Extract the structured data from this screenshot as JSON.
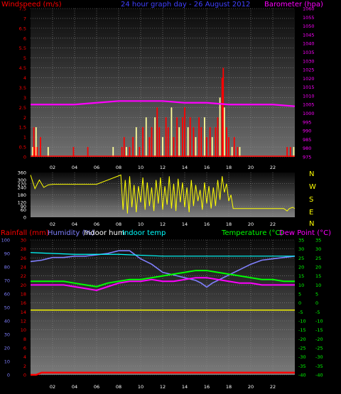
{
  "page": {
    "title_left": "Windspeed (m/s)",
    "title_mid": "24 hour graph day - 26 August 2012",
    "title_right": "Barometer (hpa)",
    "dir_letters": [
      "N",
      "W",
      "S",
      "E",
      "N"
    ],
    "bottom_labels": {
      "rain": "Rainfall (mm)",
      "hum": "Humidity (%)",
      "inhum": "Indoor hum",
      "intemp": "Indoor temp",
      "temp": "Temperature (°C)",
      "dew": "Dew Point (°C)"
    }
  },
  "colors": {
    "wind_bar": "#ff0000",
    "gust_bar": "#ffff99",
    "barometer": "#ff00ff",
    "direction": "#ffff00",
    "rain": "#ff0000",
    "humidity": "#8080ff",
    "indoor_hum": "#ffff00",
    "indoor_temp": "#00ffff",
    "temperature": "#00ff00",
    "dewpoint": "#ff00ff",
    "grid": "#8a8a8a"
  },
  "chart_data": [
    {
      "type": "bar",
      "x_ticks": [
        "02",
        "04",
        "06",
        "08",
        "10",
        "12",
        "14",
        "16",
        "18",
        "20",
        "22"
      ],
      "ylim": [
        0,
        7.5
      ],
      "y_ticks": [
        "0",
        "0.5",
        "1",
        "1.5",
        "2",
        "2.5",
        "3",
        "3.5",
        "4",
        "4.5",
        "5",
        "5.5",
        "6",
        "6.5",
        "7",
        "7.5"
      ],
      "y2lim": [
        975,
        1060
      ],
      "y2_ticks": [
        "975",
        "980",
        "985",
        "990",
        "995",
        "1000",
        "1005",
        "1010",
        "1015",
        "1020",
        "1025",
        "1030",
        "1035",
        "1040",
        "1045",
        "1050",
        "1055",
        "1060"
      ],
      "series": [
        {
          "name": "Windspeed (m/s)",
          "x": [
            0.2,
            0.3,
            0.4,
            0.5,
            0.6,
            0.9,
            1.6,
            3.9,
            5.2,
            7.5,
            8.3,
            8.5,
            8.7,
            9.0,
            9.3,
            9.6,
            9.9,
            10.2,
            10.5,
            10.8,
            11.0,
            11.3,
            11.5,
            11.7,
            12.0,
            12.3,
            12.5,
            12.8,
            13.0,
            13.3,
            13.5,
            13.8,
            14.0,
            14.3,
            14.5,
            14.8,
            15.0,
            15.3,
            15.5,
            15.8,
            16.0,
            16.3,
            16.5,
            16.8,
            17.0,
            17.2,
            17.4,
            17.5,
            17.6,
            17.8,
            18.0,
            18.3,
            18.5,
            18.8,
            19.0,
            23.3,
            23.6,
            23.9
          ],
          "y": [
            0.5,
            1.5,
            0.5,
            1.5,
            0.5,
            1,
            0.5,
            0.5,
            0.5,
            0.5,
            0.5,
            1,
            0.5,
            0.5,
            1,
            1.5,
            0.5,
            1.5,
            2,
            1,
            1.5,
            2,
            2.5,
            1.5,
            1,
            2,
            1.5,
            2.5,
            1,
            2,
            1.5,
            2,
            2.5,
            1.5,
            2,
            1.5,
            1,
            2,
            1.5,
            2,
            1,
            1.5,
            1,
            1.5,
            2,
            3,
            4,
            4.5,
            2.5,
            1.5,
            1,
            0.5,
            1,
            0.5,
            0.5,
            0.5,
            0.5,
            0.5
          ]
        },
        {
          "name": "Barometer (hpa)",
          "x": [
            0,
            2,
            4,
            6,
            8,
            10,
            12,
            14,
            16,
            18,
            20,
            22,
            24
          ],
          "y": [
            1005,
            1005,
            1005,
            1006,
            1007,
            1007,
            1007,
            1006,
            1006,
            1005,
            1005,
            1005,
            1004
          ]
        }
      ]
    },
    {
      "type": "line",
      "x_ticks": [
        "02",
        "04",
        "06",
        "08",
        "10",
        "12",
        "14",
        "16",
        "18",
        "20",
        "22"
      ],
      "ylim": [
        0,
        360
      ],
      "y_ticks": [
        "0",
        "30",
        "60",
        "90",
        "120",
        "150",
        "180",
        "210",
        "240",
        "270",
        "300",
        "330",
        "360"
      ],
      "series": [
        {
          "name": "Direction",
          "x": [
            0,
            0.4,
            0.8,
            1.2,
            1.6,
            2,
            4,
            6,
            8.2,
            8.4,
            8.6,
            8.8,
            9.0,
            9.2,
            9.4,
            9.6,
            9.8,
            10.0,
            10.2,
            10.4,
            10.6,
            10.8,
            11.0,
            11.2,
            11.4,
            11.6,
            11.8,
            12.0,
            12.2,
            12.4,
            12.6,
            12.8,
            13.0,
            13.2,
            13.4,
            13.6,
            13.8,
            14.0,
            14.2,
            14.4,
            14.6,
            14.8,
            15.0,
            15.2,
            15.4,
            15.6,
            15.8,
            16.0,
            16.2,
            16.4,
            16.6,
            16.8,
            17.0,
            17.2,
            17.4,
            17.6,
            17.8,
            18.0,
            18.2,
            18.4,
            18.6,
            19,
            21,
            23,
            23.3,
            23.5,
            23.8,
            24
          ],
          "y": [
            340,
            230,
            300,
            240,
            260,
            265,
            265,
            265,
            340,
            60,
            300,
            30,
            330,
            80,
            260,
            40,
            250,
            120,
            320,
            60,
            280,
            90,
            240,
            50,
            300,
            110,
            320,
            60,
            250,
            100,
            330,
            70,
            270,
            50,
            310,
            120,
            280,
            80,
            240,
            40,
            300,
            90,
            260,
            130,
            220,
            60,
            280,
            110,
            250,
            70,
            240,
            90,
            300,
            140,
            330,
            200,
            270,
            130,
            180,
            70,
            70,
            70,
            70,
            70,
            50,
            70,
            80,
            70
          ]
        }
      ]
    },
    {
      "type": "line",
      "x_ticks": [
        "02",
        "04",
        "06",
        "08",
        "10",
        "12",
        "14",
        "16",
        "18",
        "20",
        "22"
      ],
      "y_left_outer": {
        "label": "Humidity (%)",
        "ylim": [
          0,
          100
        ],
        "ticks": [
          "0",
          "10",
          "20",
          "30",
          "40",
          "50",
          "60",
          "70",
          "80",
          "90",
          "100"
        ]
      },
      "y_left_inner": {
        "label": "Rainfall (mm)",
        "ylim": [
          0,
          30
        ],
        "ticks": [
          "0",
          "2",
          "4",
          "6",
          "8",
          "10",
          "12",
          "14",
          "16",
          "18",
          "20",
          "22",
          "24",
          "26",
          "28",
          "30"
        ]
      },
      "y_right": {
        "label": "Temperature (°C)",
        "ylim": [
          -40,
          35
        ],
        "ticks": [
          "-40",
          "-35",
          "-30",
          "-25",
          "-20",
          "-15",
          "-10",
          "-5",
          "0",
          "5",
          "10",
          "15",
          "20",
          "25",
          "30",
          "35"
        ]
      },
      "series": [
        {
          "name": "Rainfall (mm)",
          "x": [
            0,
            0.5,
            1,
            2,
            4,
            6,
            8,
            10,
            12,
            14,
            16,
            18,
            20,
            22,
            24
          ],
          "y": [
            0,
            0,
            0.5,
            0.5,
            0.5,
            0.5,
            0.5,
            0.5,
            0.5,
            0.5,
            0.5,
            0.5,
            0.5,
            0.5,
            0.5
          ]
        },
        {
          "name": "Humidity (%)",
          "x": [
            0,
            1,
            2,
            3,
            4,
            5,
            6,
            7,
            8,
            9,
            10,
            11,
            12,
            13,
            14,
            15,
            15.5,
            16,
            16.5,
            17,
            18,
            19,
            20,
            21,
            22,
            23,
            24
          ],
          "y": [
            84,
            85,
            87,
            87,
            88,
            88,
            89,
            90,
            92,
            92,
            86,
            82,
            76,
            74,
            72,
            70,
            68,
            65,
            68,
            70,
            74,
            78,
            82,
            85,
            86,
            87,
            88
          ]
        },
        {
          "name": "Indoor hum",
          "x": [
            0,
            4,
            8,
            12,
            16,
            20,
            24
          ],
          "y": [
            48,
            48,
            48,
            48,
            48,
            48,
            48
          ]
        },
        {
          "name": "Indoor temp",
          "x": [
            0,
            4,
            8,
            12,
            16,
            20,
            24
          ],
          "y": [
            28,
            27,
            27,
            26,
            26,
            26,
            26
          ]
        },
        {
          "name": "Temperature (°C)",
          "x": [
            0,
            1,
            2,
            3,
            4,
            5,
            6,
            7,
            8,
            9,
            10,
            11,
            12,
            13,
            14,
            15,
            16,
            17,
            18,
            19,
            20,
            21,
            22,
            23,
            24
          ],
          "y": [
            12,
            12,
            12,
            12,
            11,
            10,
            9,
            11,
            12,
            13,
            13,
            14,
            15,
            16,
            17,
            18,
            18,
            17,
            16,
            15,
            14,
            13,
            13,
            12,
            12
          ]
        },
        {
          "name": "Dew Point (°C)",
          "x": [
            0,
            1,
            2,
            3,
            4,
            5,
            6,
            7,
            8,
            9,
            10,
            11,
            12,
            13,
            14,
            15,
            16,
            17,
            18,
            19,
            20,
            21,
            22,
            23,
            24
          ],
          "y": [
            10,
            10,
            10,
            10,
            9,
            8,
            7,
            9,
            11,
            12,
            12,
            13,
            12,
            12,
            13,
            14,
            14,
            13,
            12,
            11,
            11,
            10,
            10,
            10,
            10
          ]
        }
      ]
    }
  ]
}
